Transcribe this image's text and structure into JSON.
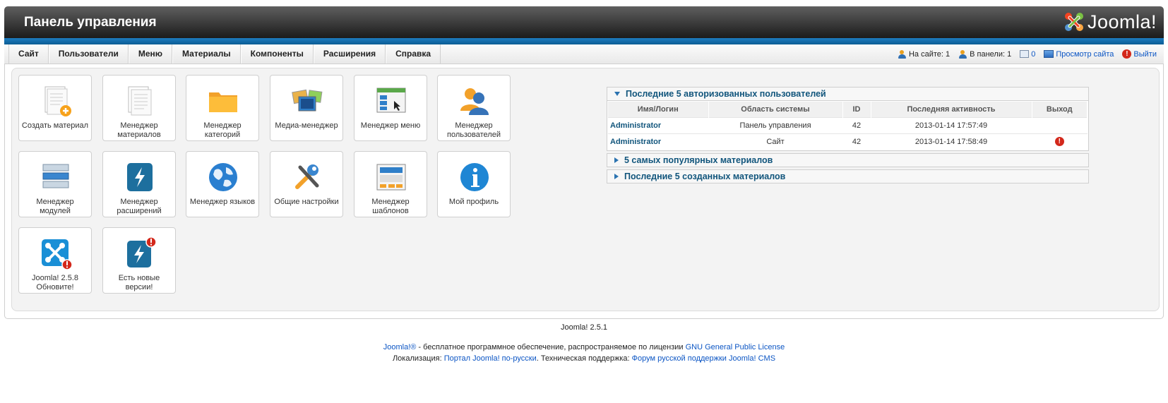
{
  "header": {
    "title": "Панель управления",
    "logo_text": "Joomla!"
  },
  "menu": [
    {
      "label": "Сайт"
    },
    {
      "label": "Пользователи"
    },
    {
      "label": "Меню"
    },
    {
      "label": "Материалы"
    },
    {
      "label": "Компоненты"
    },
    {
      "label": "Расширения"
    },
    {
      "label": "Справка"
    }
  ],
  "status": {
    "on_site": "На сайте: 1",
    "in_panel": "В панели: 1",
    "messages": "0",
    "view_site": "Просмотр сайта",
    "logout": "Выйти"
  },
  "quickicons": [
    {
      "label": "Создать материал",
      "icon": "add-article-icon"
    },
    {
      "label": "Менеджер материалов",
      "icon": "article-manager-icon"
    },
    {
      "label": "Менеджер категорий",
      "icon": "category-folder-icon"
    },
    {
      "label": "Медиа-менеджер",
      "icon": "media-manager-icon"
    },
    {
      "label": "Менеджер меню",
      "icon": "menu-manager-icon"
    },
    {
      "label": "Менеджер пользователей",
      "icon": "user-manager-icon"
    },
    {
      "label": "Менеджер модулей",
      "icon": "module-manager-icon"
    },
    {
      "label": "Менеджер расширений",
      "icon": "extension-manager-icon"
    },
    {
      "label": "Менеджер языков",
      "icon": "language-globe-icon"
    },
    {
      "label": "Общие настройки",
      "icon": "global-config-tools-icon"
    },
    {
      "label": "Менеджер шаблонов",
      "icon": "template-manager-icon"
    },
    {
      "label": "Мой профиль",
      "icon": "profile-info-icon"
    },
    {
      "label": "Joomla! 2.5.8 Обновите!",
      "icon": "joomla-update-icon"
    },
    {
      "label": "Есть новые версии!",
      "icon": "extension-update-icon"
    }
  ],
  "logged_users": {
    "title": "Последние 5 авторизованных пользователей",
    "columns": [
      "Имя/Логин",
      "Область системы",
      "ID",
      "Последняя активность",
      "Выход"
    ],
    "rows": [
      {
        "name": "Administrator",
        "area": "Панель управления",
        "id": "42",
        "activity": "2013-01-14 17:57:49",
        "logout": false
      },
      {
        "name": "Administrator",
        "area": "Сайт",
        "id": "42",
        "activity": "2013-01-14 17:58:49",
        "logout": true
      }
    ]
  },
  "popular": {
    "title": "5 самых популярных материалов"
  },
  "latest": {
    "title": "Последние 5 созданных материалов"
  },
  "footer": {
    "version": "Joomla! 2.5.1",
    "line2_link1": "Joomla!®",
    "line2_text": " - бесплатное программное обеспечение, распространяемое по лицензии ",
    "line2_link2": "GNU General Public License",
    "line3_text1": "Локализация: ",
    "line3_link1": "Портал Joomla! по-русски",
    "line3_text2": ". Техническая поддержка: ",
    "line3_link2": "Форум русской поддержки Joomla! CMS"
  }
}
